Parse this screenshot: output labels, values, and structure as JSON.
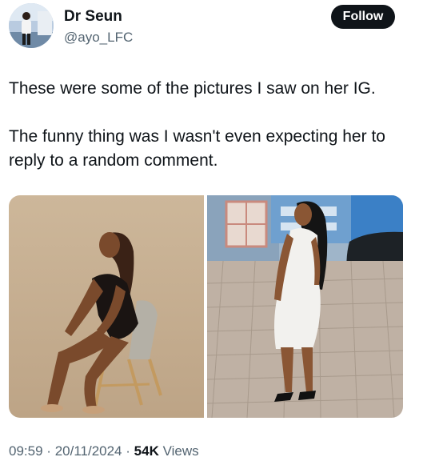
{
  "author": {
    "display_name": "Dr Seun",
    "handle": "@ayo_LFC"
  },
  "actions": {
    "follow_label": "Follow"
  },
  "tweet": {
    "paragraphs": [
      "These were some of the pictures I saw on her IG.",
      "The funny thing was I wasn't even expecting her to reply to a random comment."
    ]
  },
  "media": {
    "photo_count": 2
  },
  "meta": {
    "time": "09:59",
    "separator": "·",
    "date": "20/11/2024",
    "views_count": "54K",
    "views_label": "Views"
  },
  "colors": {
    "text_primary": "#0f1419",
    "text_secondary": "#536471",
    "follow_button_bg": "#0f1419",
    "follow_button_text": "#ffffff"
  }
}
